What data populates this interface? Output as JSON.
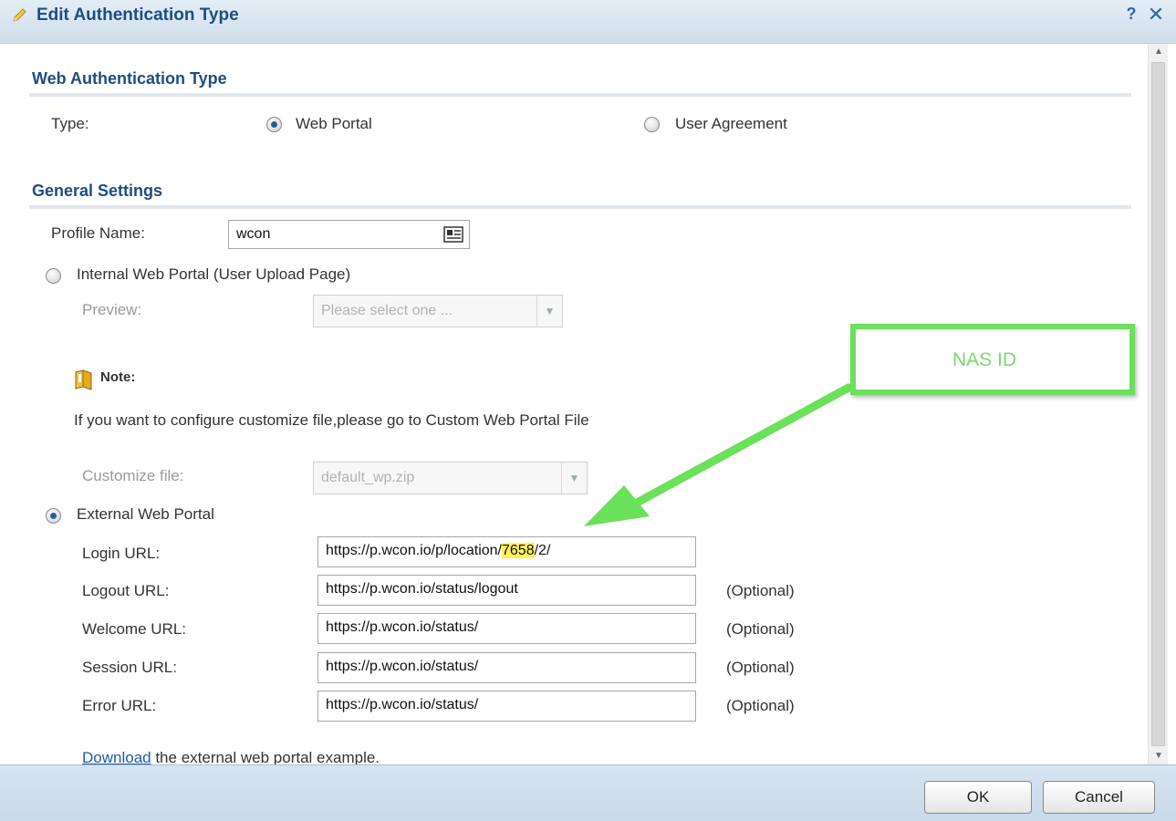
{
  "dialog": {
    "title": "Edit Authentication Type",
    "help_label": "?",
    "close_label": "✕"
  },
  "web_auth": {
    "section_title": "Web Authentication Type",
    "type_label": "Type:",
    "options": [
      {
        "label": "Web Portal",
        "selected": true
      },
      {
        "label": "User Agreement",
        "selected": false
      }
    ]
  },
  "general": {
    "section_title": "General Settings",
    "profile_name_label": "Profile Name:",
    "profile_name_value": "wcon",
    "internal_portal_label": "Internal Web Portal (User Upload Page)",
    "internal_portal_selected": false,
    "preview_label": "Preview:",
    "preview_placeholder": "Please select one ...",
    "note_title": "Note:",
    "note_text": "If you want to configure customize file,please go to Custom Web Portal File",
    "customize_file_label": "Customize file:",
    "customize_file_value": "default_wp.zip",
    "external_portal_label": "External Web Portal",
    "external_portal_selected": true,
    "urls": {
      "login_label": "Login URL:",
      "login_value_prefix": "https://p.wcon.io/p/location/",
      "login_value_highlight": "7658",
      "login_value_suffix": "/2/",
      "logout_label": "Logout URL:",
      "logout_value": "https://p.wcon.io/status/logout",
      "welcome_label": "Welcome URL:",
      "welcome_value": "https://p.wcon.io/status/",
      "session_label": "Session URL:",
      "session_value": "https://p.wcon.io/status/",
      "error_label": "Error URL:",
      "error_value": "https://p.wcon.io/status/",
      "optional_label": "(Optional)"
    },
    "download_link": "Download",
    "download_text": " the external web portal example."
  },
  "annotation": {
    "label": "NAS ID",
    "color": "#6be05a"
  },
  "footer": {
    "ok_label": "OK",
    "cancel_label": "Cancel"
  }
}
